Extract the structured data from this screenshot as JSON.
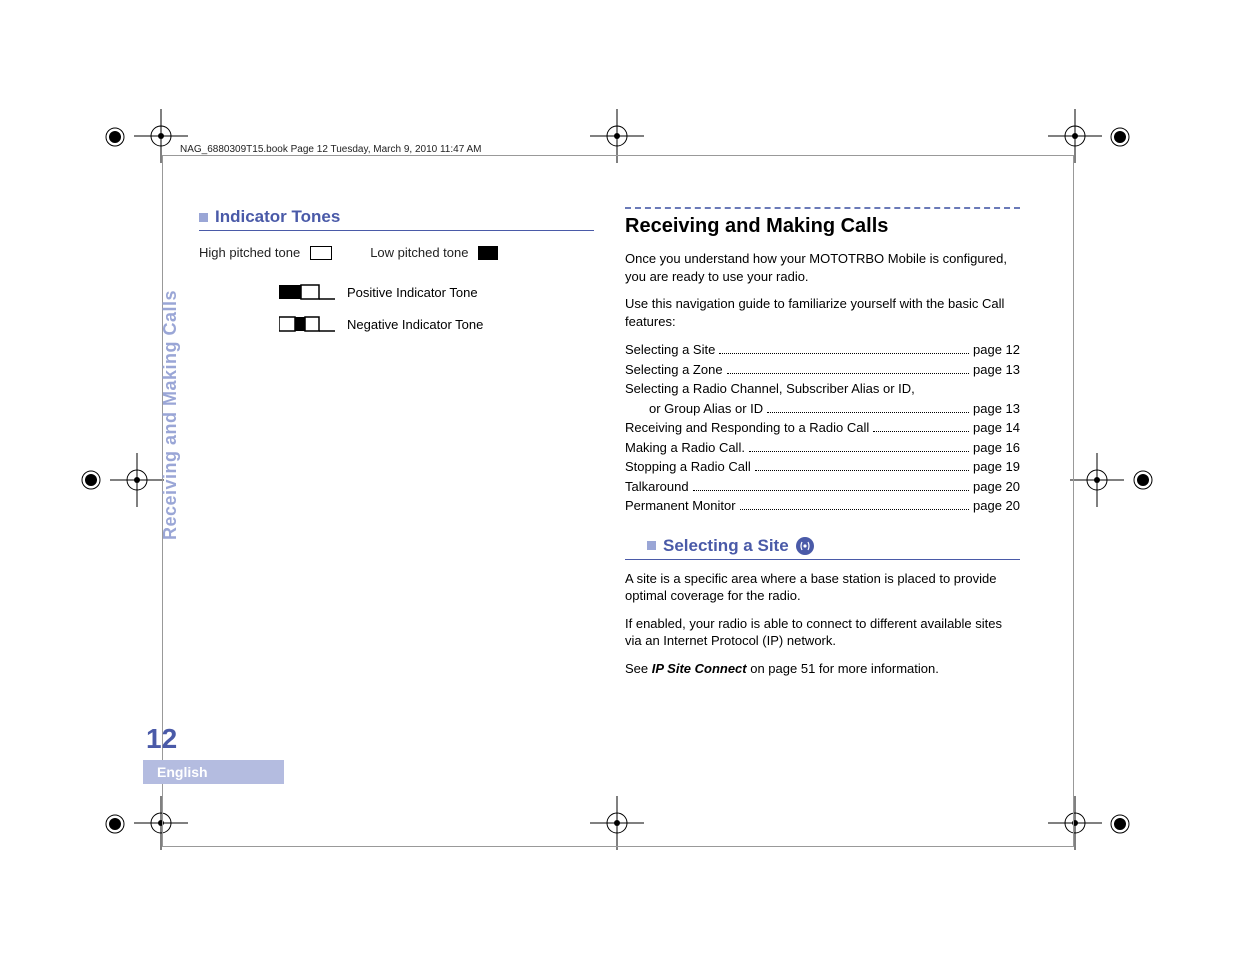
{
  "header_tag": "NAG_6880309T15.book  Page 12  Tuesday, March 9, 2010  11:47 AM",
  "side_title": "Receiving and Making Calls",
  "page_number": "12",
  "language_tab": "English",
  "left": {
    "heading": "Indicator Tones",
    "high_label": "High pitched tone",
    "low_label": "Low pitched tone",
    "positive_label": "Positive Indicator Tone",
    "negative_label": "Negative Indicator Tone"
  },
  "right": {
    "main_heading": "Receiving and Making Calls",
    "intro1": "Once you understand how your MOTOTRBO Mobile is configured, you are ready to use your radio.",
    "intro2": "Use this navigation guide to familiarize yourself with the basic Call features:",
    "toc": [
      {
        "label": "Selecting a Site",
        "page": "page 12"
      },
      {
        "label": "Selecting a Zone",
        "page": "page 13"
      },
      {
        "label": "Selecting a Radio Channel, Subscriber Alias or ID,",
        "page": ""
      },
      {
        "label_indent": "or Group Alias or ID",
        "page": "page 13"
      },
      {
        "label": "Receiving and Responding to a Radio Call",
        "page": "page 14"
      },
      {
        "label": "Making a Radio Call.",
        "page": "page 16"
      },
      {
        "label": "Stopping a Radio Call",
        "page": "page 19"
      },
      {
        "label": "Talkaround",
        "page": "page 20"
      },
      {
        "label": "Permanent Monitor",
        "page": "page 20"
      }
    ],
    "sub_heading": "Selecting a Site",
    "p1": "A site is a specific area where a base station is placed to provide optimal coverage for the radio.",
    "p2": "If enabled, your radio is able to connect to different available sites via an Internet Protocol (IP) network.",
    "p3_pre": "See ",
    "p3_bold": "IP Site Connect",
    "p3_post": " on page 51 for more information."
  }
}
